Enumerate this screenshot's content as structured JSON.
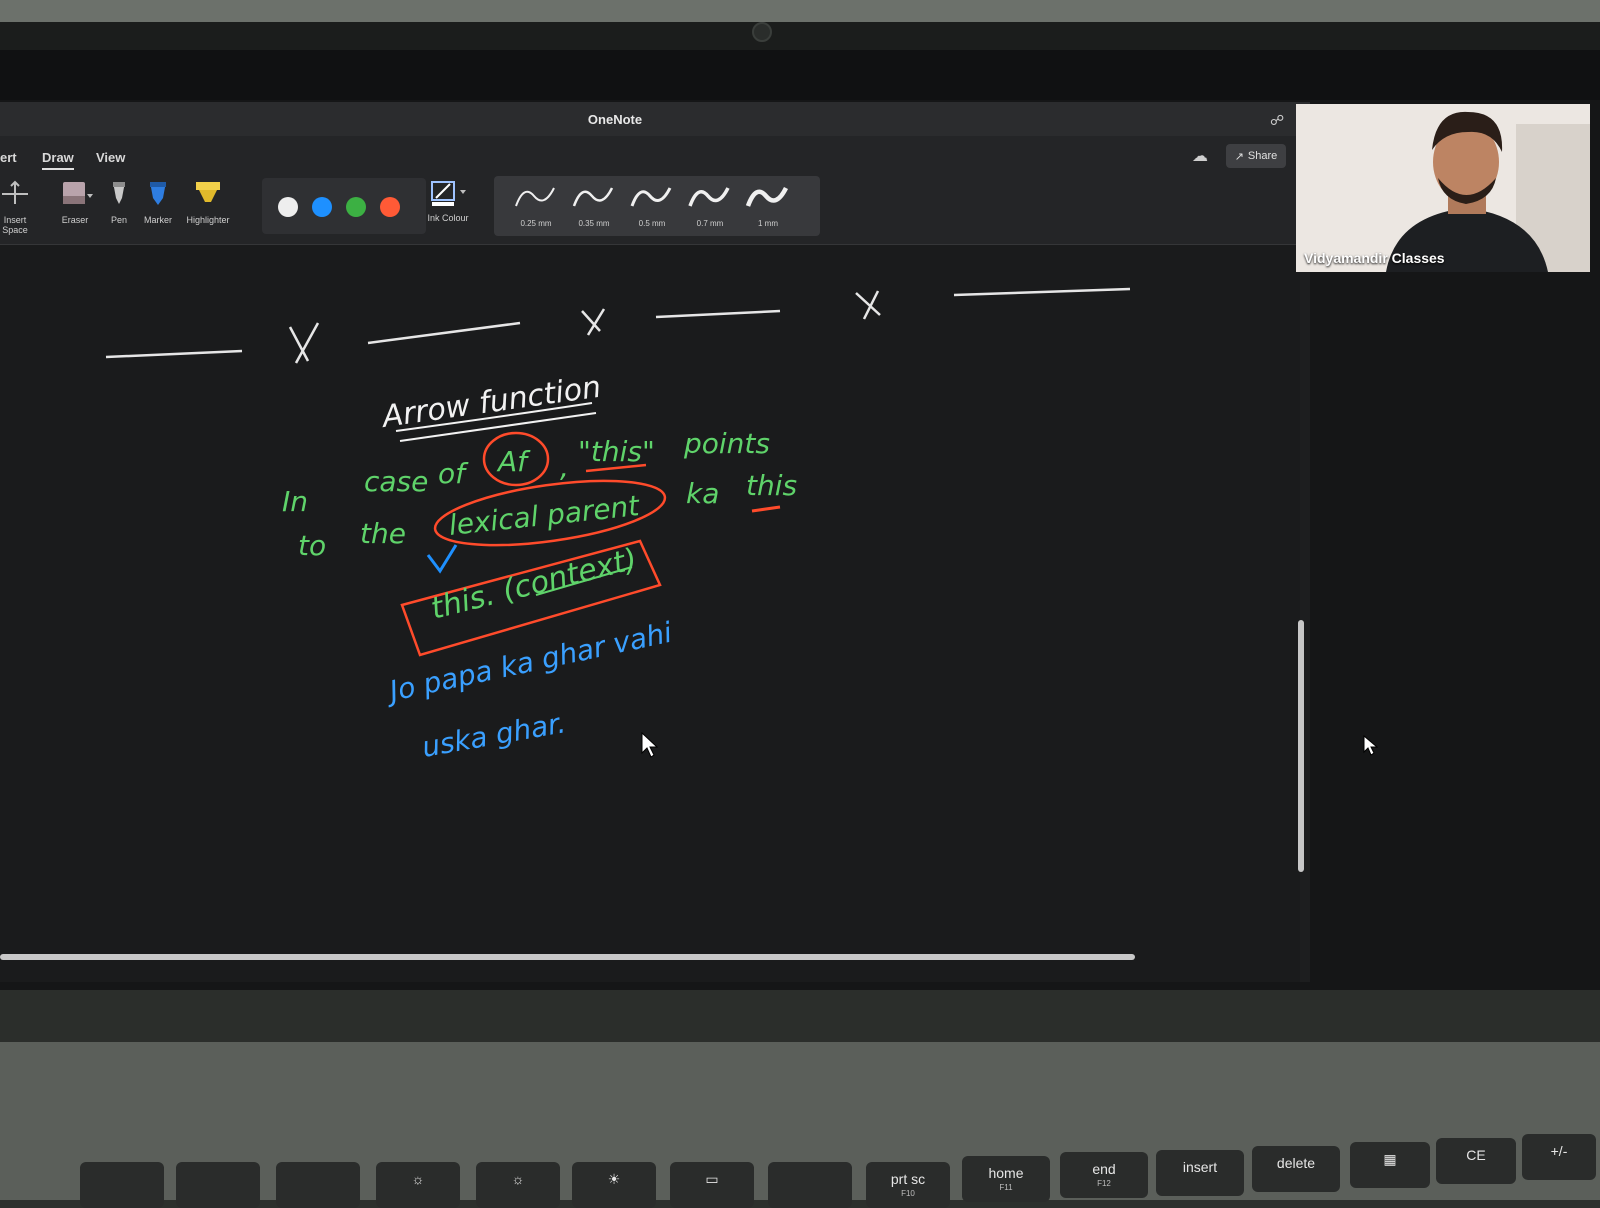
{
  "window": {
    "title": "OneNote"
  },
  "ribbon": {
    "tabs": [
      "ert",
      "Draw",
      "View"
    ],
    "share_label": "Share",
    "tools": [
      "Insert Space",
      "Eraser",
      "Pen",
      "Marker",
      "Highlighter"
    ],
    "ink_colour_label": "Ink Colour",
    "colors": [
      "#eeeeee",
      "#1e90ff",
      "#3cb043",
      "#ff5a36"
    ],
    "thicknesses": [
      "0.25 mm",
      "0.35 mm",
      "0.5 mm",
      "0.7 mm",
      "1 mm"
    ]
  },
  "participant": {
    "name": "Vidyamandir Classes"
  },
  "notes": {
    "heading": "Arrow function",
    "line1": [
      "In",
      "case",
      "of",
      "Af",
      ",",
      "\"this\"",
      "points"
    ],
    "line2": [
      "to",
      "the",
      "lexical parent",
      "ka",
      "this"
    ],
    "boxed": "this. (context)",
    "blue1": "Jo papa ka ghar vahi",
    "blue2": "uska ghar."
  },
  "keyboard": {
    "keys": [
      "prt sc",
      "home",
      "end",
      "insert",
      "delete",
      "CE",
      "+/-"
    ],
    "fn_labels": [
      "F10",
      "F11",
      "F12"
    ]
  }
}
